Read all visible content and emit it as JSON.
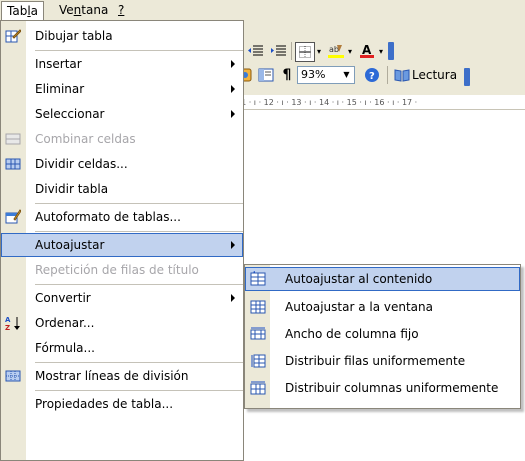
{
  "menubar": {
    "items": [
      {
        "label": "Tabla"
      },
      {
        "label": "Ventana"
      },
      {
        "label": "?"
      }
    ]
  },
  "toolbar": {
    "zoom": "93%",
    "lectura_label": "Lectura"
  },
  "ruler": {
    "text": "11 · ı · 12 · ı · 13 · ı · 14 · ı · 15 · ı · 16 · ı · 17 ·"
  },
  "menu": {
    "items": [
      {
        "label": "Dibujar tabla",
        "icon": "pencil-icon",
        "disabled": false,
        "submenu": false
      },
      {
        "label": "Insertar",
        "icon": "",
        "disabled": false,
        "submenu": true
      },
      {
        "label": "Eliminar",
        "icon": "",
        "disabled": false,
        "submenu": true
      },
      {
        "label": "Seleccionar",
        "icon": "",
        "disabled": false,
        "submenu": true
      },
      {
        "label": "Combinar celdas",
        "icon": "merge-cells-icon",
        "disabled": true,
        "submenu": false
      },
      {
        "label": "Dividir celdas...",
        "icon": "split-cells-icon",
        "disabled": false,
        "submenu": false
      },
      {
        "label": "Dividir tabla",
        "icon": "",
        "disabled": false,
        "submenu": false
      },
      {
        "label": "Autoformato de tablas...",
        "icon": "autoformat-icon",
        "disabled": false,
        "submenu": false
      },
      {
        "label": "Autoajustar",
        "icon": "",
        "disabled": false,
        "submenu": true,
        "highlighted": true
      },
      {
        "label": "Repetición de filas de título",
        "icon": "",
        "disabled": true,
        "submenu": false
      },
      {
        "label": "Convertir",
        "icon": "",
        "disabled": false,
        "submenu": true
      },
      {
        "label": "Ordenar...",
        "icon": "sort-az-icon",
        "disabled": false,
        "submenu": false
      },
      {
        "label": "Fórmula...",
        "icon": "",
        "disabled": false,
        "submenu": false
      },
      {
        "label": "Mostrar líneas de división",
        "icon": "gridlines-icon",
        "disabled": false,
        "submenu": false
      },
      {
        "label": "Propiedades de tabla...",
        "icon": "",
        "disabled": false,
        "submenu": false
      }
    ]
  },
  "submenu": {
    "items": [
      {
        "label": "Autoajustar al contenido",
        "icon": "autofit-contents-icon",
        "highlighted": true
      },
      {
        "label": "Autoajustar a la ventana",
        "icon": "autofit-window-icon"
      },
      {
        "label": "Ancho de columna fijo",
        "icon": "fixed-column-width-icon"
      },
      {
        "label": "Distribuir filas uniformemente",
        "icon": "distribute-rows-icon"
      },
      {
        "label": "Distribuir columnas uniformemente",
        "icon": "distribute-columns-icon"
      }
    ]
  },
  "colors": {
    "highlight_bg": "#c1d2ee",
    "highlight_border": "#316ac5",
    "gutter": "#ece9d8",
    "disabled_text": "#a7a6aa"
  }
}
